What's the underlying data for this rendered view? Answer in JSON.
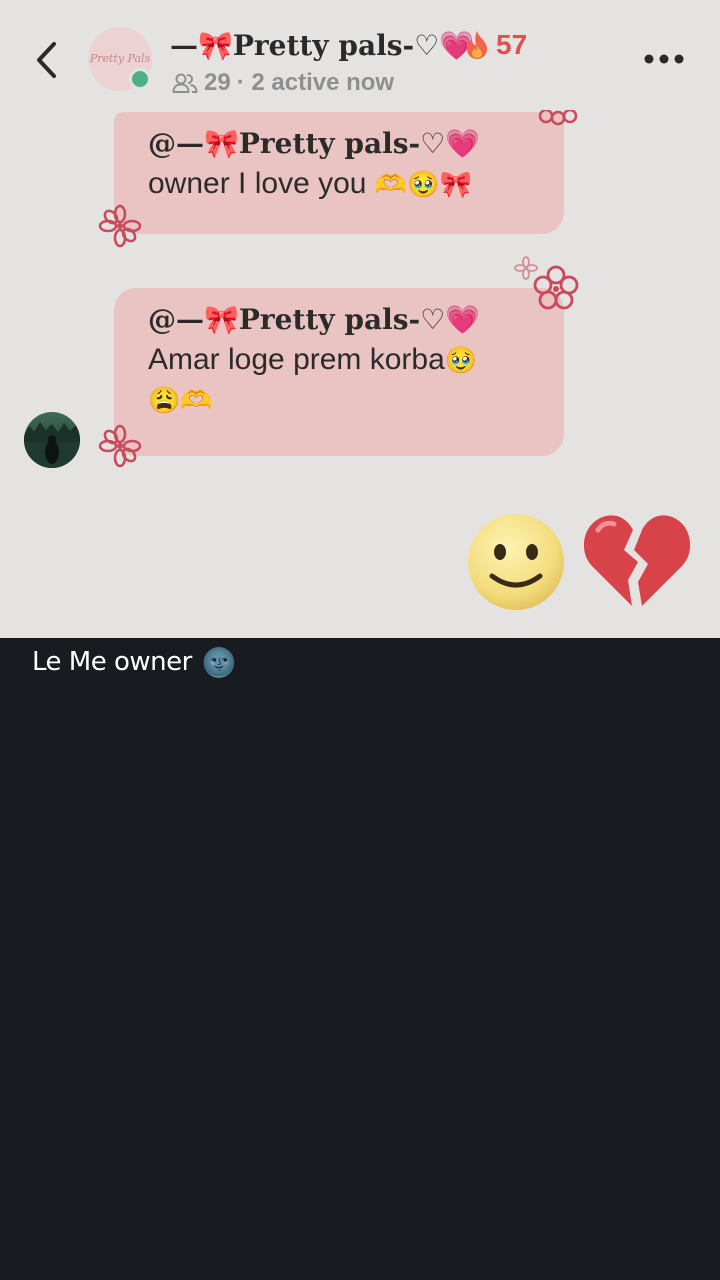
{
  "header": {
    "group_name": "—🎀Pretty pals-♡",
    "group_name_emoji": "💗",
    "avatar_text": "Pretty Pals",
    "streak_icon": "fire-icon",
    "streak_count": "57",
    "member_count": "29",
    "active_status": "· 2 active now"
  },
  "messages": [
    {
      "mention": "@—🎀Pretty pals-♡",
      "mention_emoji": "💗",
      "text": "owner I love you",
      "emojis": "🫶🥹🎀"
    },
    {
      "mention": "@—🎀Pretty pals-♡",
      "mention_emoji": "💗",
      "text": "Amar loge prem korba",
      "emojis_inline": "🥹",
      "emojis_line2": "😩🫶"
    }
  ],
  "sent_reaction": {
    "emoji_1": "🙂",
    "emoji_2": "💔"
  },
  "caption": {
    "text": "Le Me owner",
    "emoji": "🌚"
  },
  "colors": {
    "chat_background": "#e4e3e1",
    "bubble": "#e9c4c2",
    "streak": "#e04f51",
    "online": "#4fb083",
    "bottom_background": "#181b1f"
  }
}
